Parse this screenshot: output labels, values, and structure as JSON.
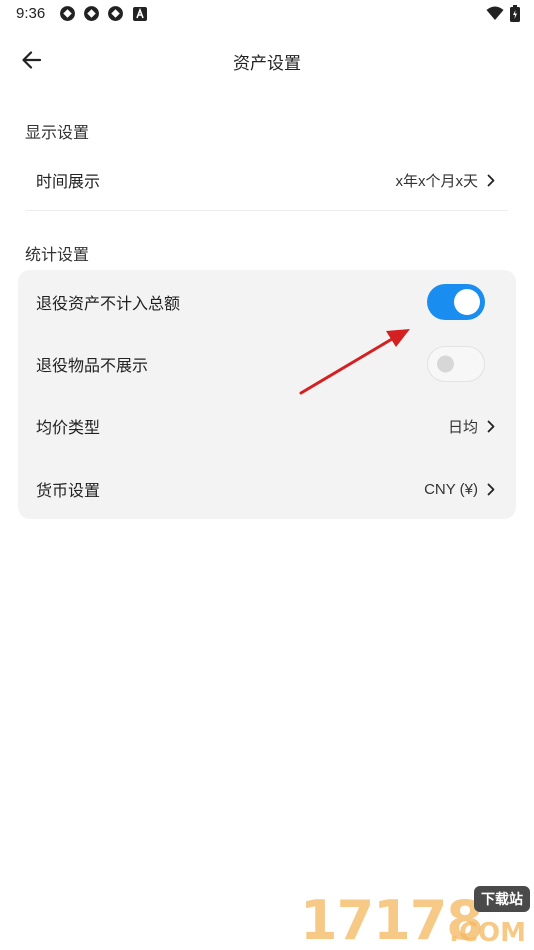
{
  "status_bar": {
    "time": "9:36",
    "notification_icons": [
      "app-icon",
      "app-icon",
      "app-icon",
      "a-badge-icon"
    ],
    "right_icons": [
      "wifi-icon",
      "battery-icon"
    ]
  },
  "app_bar": {
    "title": "资产设置",
    "back_icon": "arrow-left-icon"
  },
  "display_section": {
    "label": "显示设置",
    "items": [
      {
        "label": "时间展示",
        "value": "x年x个月x天"
      }
    ]
  },
  "stats_section": {
    "label": "统计设置",
    "items": [
      {
        "label": "退役资产不计入总额",
        "toggle": true
      },
      {
        "label": "退役物品不展示",
        "toggle": false
      },
      {
        "label": "均价类型",
        "value": "日均"
      },
      {
        "label": "货币设置",
        "value": "CNY (¥)"
      }
    ]
  },
  "colors": {
    "accent": "#1a8ef0",
    "card_bg": "#f3f3f4",
    "annotation_arrow": "#d42020"
  },
  "watermark": {
    "digits": "17178",
    "badge": "下载站",
    "suffix": ".COM"
  }
}
